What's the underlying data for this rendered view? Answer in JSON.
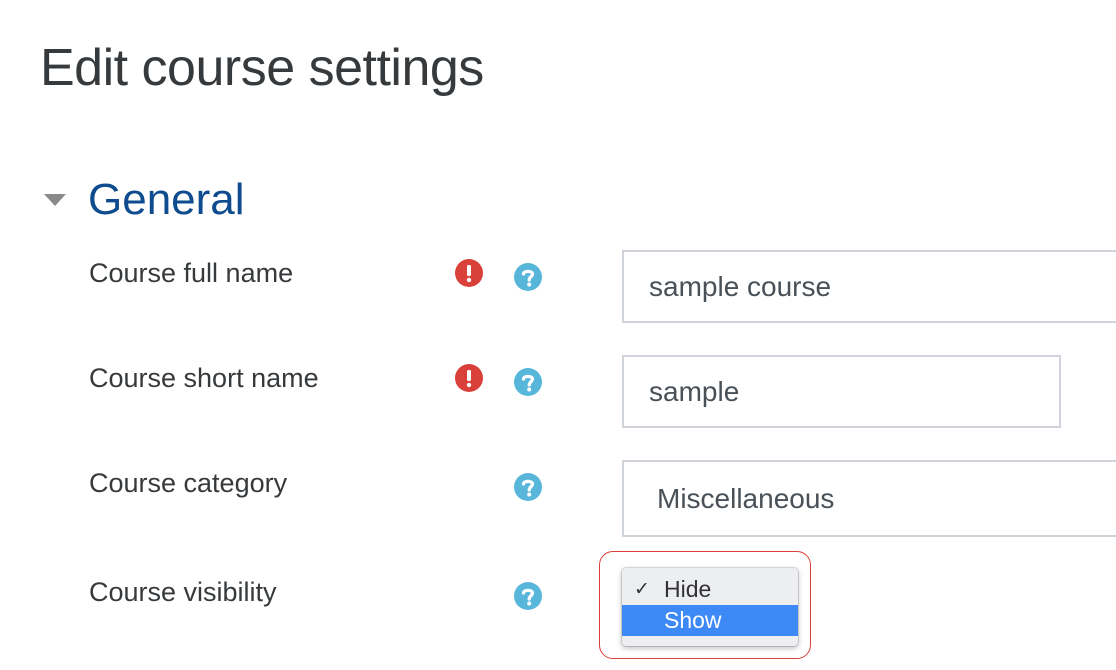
{
  "page": {
    "title": "Edit course settings"
  },
  "section": {
    "title": "General",
    "expanded": true
  },
  "fields": {
    "full_name": {
      "label": "Course full name",
      "value": "sample course",
      "required": true
    },
    "short_name": {
      "label": "Course short name",
      "value": "sample",
      "required": true
    },
    "category": {
      "label": "Course category",
      "value": "Miscellaneous"
    },
    "visibility": {
      "label": "Course visibility",
      "options": [
        "Hide",
        "Show"
      ],
      "checked_option": "Hide",
      "highlighted_option": "Show"
    }
  },
  "colors": {
    "required_icon": "#d9403a",
    "help_icon": "#58b6db",
    "section_title": "#0f4b8f",
    "highlighted_option_bg": "#3d8af7",
    "annotation_ring": "#d9403a"
  },
  "icons": {
    "required": "exclamation-circle-icon",
    "help": "question-circle-icon",
    "toggle": "caret-down-icon",
    "check": "checkmark-icon"
  }
}
